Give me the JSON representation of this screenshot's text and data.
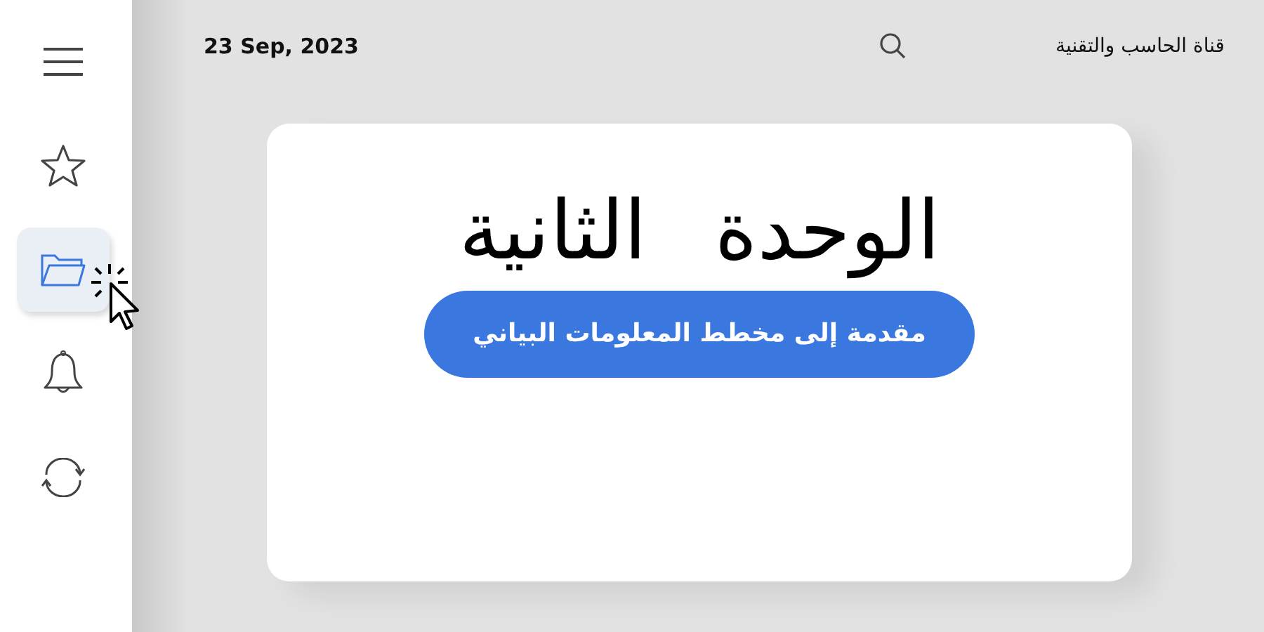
{
  "header": {
    "date": "23 Sep, 2023",
    "channel": "قناة الحاسب والتقنية"
  },
  "sidebar": {
    "items": [
      {
        "kind": "menu",
        "selected": false
      },
      {
        "kind": "star",
        "selected": false
      },
      {
        "kind": "folder",
        "selected": true
      },
      {
        "kind": "bell",
        "selected": false
      },
      {
        "kind": "refresh",
        "selected": false
      }
    ]
  },
  "card": {
    "title": "الوحدة الثانية",
    "subtitle": "مقدمة إلى مخطط المعلومات البياني"
  }
}
